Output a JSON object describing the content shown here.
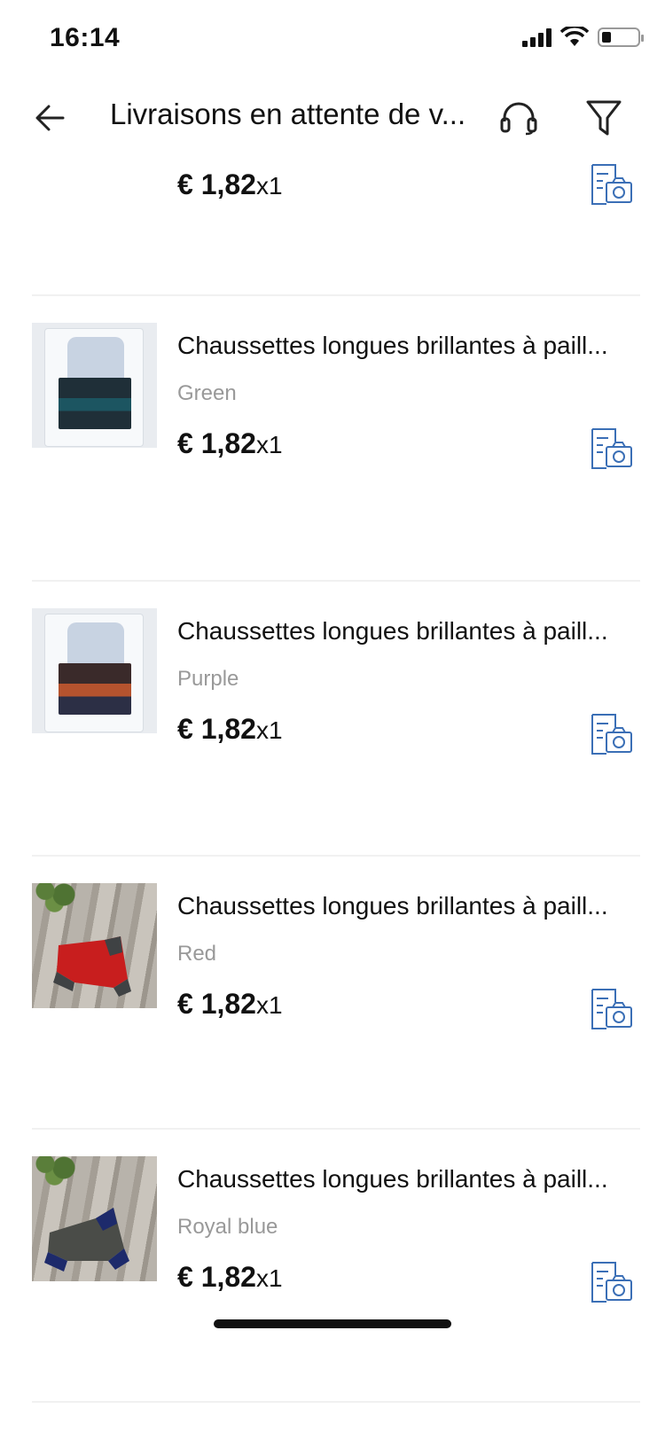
{
  "status_bar": {
    "time": "16:14"
  },
  "nav": {
    "title": "Livraisons en attente de v...",
    "back_icon": "arrow-left-icon",
    "support_icon": "headset-icon",
    "filter_icon": "filter-icon"
  },
  "items": [
    {
      "title": "",
      "variant": "",
      "price": "€ 1,82",
      "qty": "x1"
    },
    {
      "title": "Chaussettes longues brillantes à paill...",
      "variant": "Green",
      "price": "€ 1,82",
      "qty": "x1"
    },
    {
      "title": "Chaussettes longues brillantes à paill...",
      "variant": "Purple",
      "price": "€ 1,82",
      "qty": "x1"
    },
    {
      "title": "Chaussettes longues brillantes à paill...",
      "variant": "Red",
      "price": "€ 1,82",
      "qty": "x1"
    },
    {
      "title": "Chaussettes longues brillantes à paill...",
      "variant": "Royal blue",
      "price": "€ 1,82",
      "qty": "x1"
    }
  ],
  "colors": {
    "accent": "#3b6fb6",
    "muted_text": "#999999",
    "divider": "#f1f1f1"
  }
}
